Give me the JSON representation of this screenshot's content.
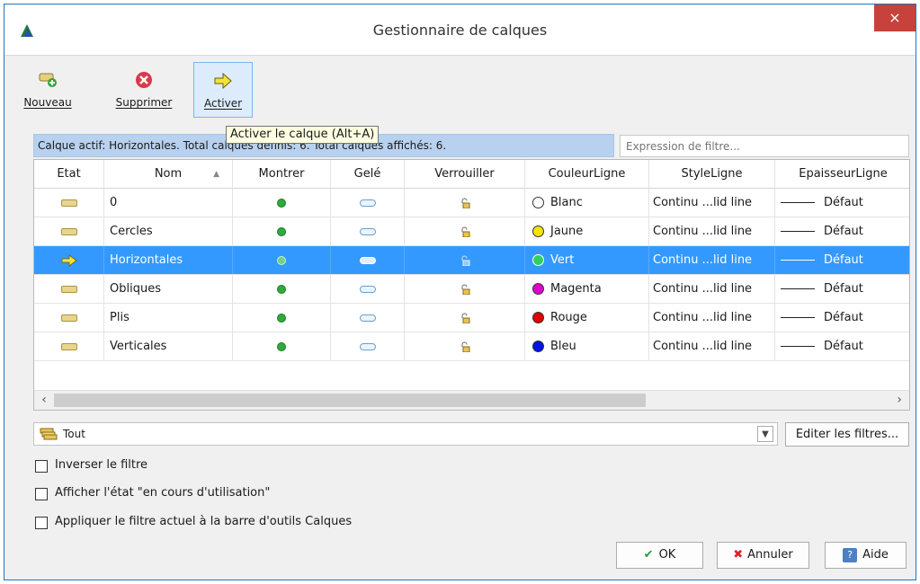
{
  "window": {
    "title": "Gestionnaire de calques",
    "close_glyph": "×"
  },
  "toolbar": {
    "new_label": "Nouveau",
    "delete_label": "Supprimer",
    "activate_label": "Activer"
  },
  "tooltip": "Activer le calque (Alt+A)",
  "status": "Calque actif: Horizontales. Total calques définis: 6. Total calques affichés: 6.",
  "filter": {
    "placeholder": "Expression de filtre..."
  },
  "table": {
    "headers": [
      "Etat",
      "Nom",
      "Montrer",
      "Gelé",
      "Verrouiller",
      "CouleurLigne",
      "StyleLigne",
      "EpaisseurLigne"
    ],
    "rows": [
      {
        "name": "0",
        "color_name": "Blanc",
        "color": "#ffffff",
        "style": "Continu ...lid line",
        "weight": "Défaut"
      },
      {
        "name": "Cercles",
        "color_name": "Jaune",
        "color": "#f5e400",
        "style": "Continu ...lid line",
        "weight": "Défaut"
      },
      {
        "name": "Horizontales",
        "color_name": "Vert",
        "color": "#2fd060",
        "style": "Continu ...lid line",
        "weight": "Défaut"
      },
      {
        "name": "Obliques",
        "color_name": "Magenta",
        "color": "#e000d0",
        "style": "Continu ...lid line",
        "weight": "Défaut"
      },
      {
        "name": "Plis",
        "color_name": "Rouge",
        "color": "#e00000",
        "style": "Continu ...lid line",
        "weight": "Défaut"
      },
      {
        "name": "Verticales",
        "color_name": "Bleu",
        "color": "#0014e0",
        "style": "Continu ...lid line",
        "weight": "Défaut"
      }
    ],
    "selected_row": "Horizontales"
  },
  "filter_combo": {
    "value": "Tout",
    "edit_button": "Editer les filtres..."
  },
  "options": {
    "invert": "Inverser le filtre",
    "in_use": "Afficher l'état \"en cours d'utilisation\"",
    "apply_toolbar": "Appliquer le filtre actuel à la barre d'outils Calques"
  },
  "buttons": {
    "ok": "OK",
    "cancel": "Annuler",
    "help": "Aide"
  },
  "colors": {
    "accent": "#3399ff",
    "title_close": "#c7423a",
    "status_bg": "#b7d1ee"
  }
}
